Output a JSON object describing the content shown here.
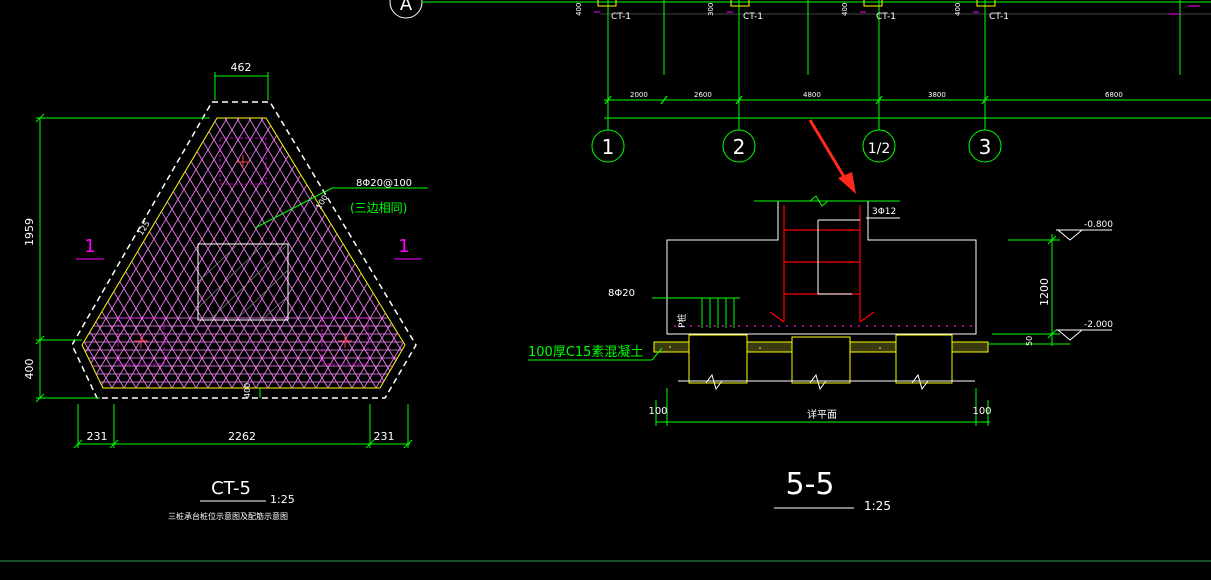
{
  "grid": {
    "top_axis_label": "A",
    "column_tag": "CT-1",
    "small_dims": [
      "400",
      "300",
      "400",
      "400"
    ],
    "span_dims": [
      "2000",
      "2600",
      "4800",
      "3800",
      "6800"
    ],
    "axis_labels": [
      "1",
      "2",
      "1/2",
      "3"
    ]
  },
  "left_plan": {
    "top_width_dim": "462",
    "height_dim": "1959",
    "bottom_height_dim": "400",
    "section_marks": [
      "1",
      "1"
    ],
    "rebar_note": "8Φ20@100",
    "rebar_note_sub": "(三边相同)",
    "edge_dim_right": "100",
    "edge_dim_left": "125",
    "bottom_inner_dim": "400",
    "bottom_dims": [
      "231",
      "2262",
      "231"
    ],
    "title": "CT-5",
    "scale": "1:25",
    "subtitle": "三桩承台桩位示意图及配筋示意图"
  },
  "section": {
    "top_bar_note": "3Φ12",
    "left_bar_note": "8Φ20",
    "pile_label": "P桩",
    "elev_top": "-0.800",
    "elev_bottom": "-2.000",
    "height_dim": "1200",
    "small_dim": "50",
    "concrete_note": "100厚C15素混凝土",
    "bottom_dims": [
      "100",
      "详平面",
      "100"
    ],
    "title": "5-5",
    "scale": "1:25"
  },
  "colors": {
    "background": "#000000",
    "green": "#00ff00",
    "white": "#ffffff",
    "magenta": "#ff00ff",
    "yellow": "#ffff00",
    "red": "#ff0000",
    "pink": "#ff88ff",
    "arrow": "#ff2a1a",
    "grey": "#808080"
  }
}
